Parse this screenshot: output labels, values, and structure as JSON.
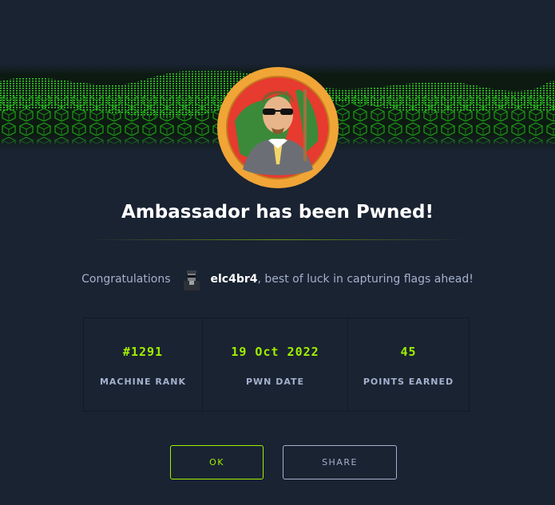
{
  "modal": {
    "title": "Ambassador has been Pwned!",
    "congrats_prefix": "Congratulations",
    "username": "elc4br4",
    "congrats_suffix": ", best of luck in capturing flags ahead!",
    "stats": [
      {
        "value": "#1291",
        "label": "MACHINE RANK"
      },
      {
        "value": "19 Oct 2022",
        "label": "PWN DATE"
      },
      {
        "value": "45",
        "label": "POINTS EARNED"
      }
    ],
    "buttons": {
      "ok": "OK",
      "share": "SHARE"
    }
  },
  "icons": {
    "machine": "machine-avatar-icon",
    "user": "user-avatar-icon"
  },
  "colors": {
    "background": "#1a2332",
    "accent": "#9fef00",
    "muted": "#a4b1cd",
    "badge_ring": "#f0a536"
  }
}
